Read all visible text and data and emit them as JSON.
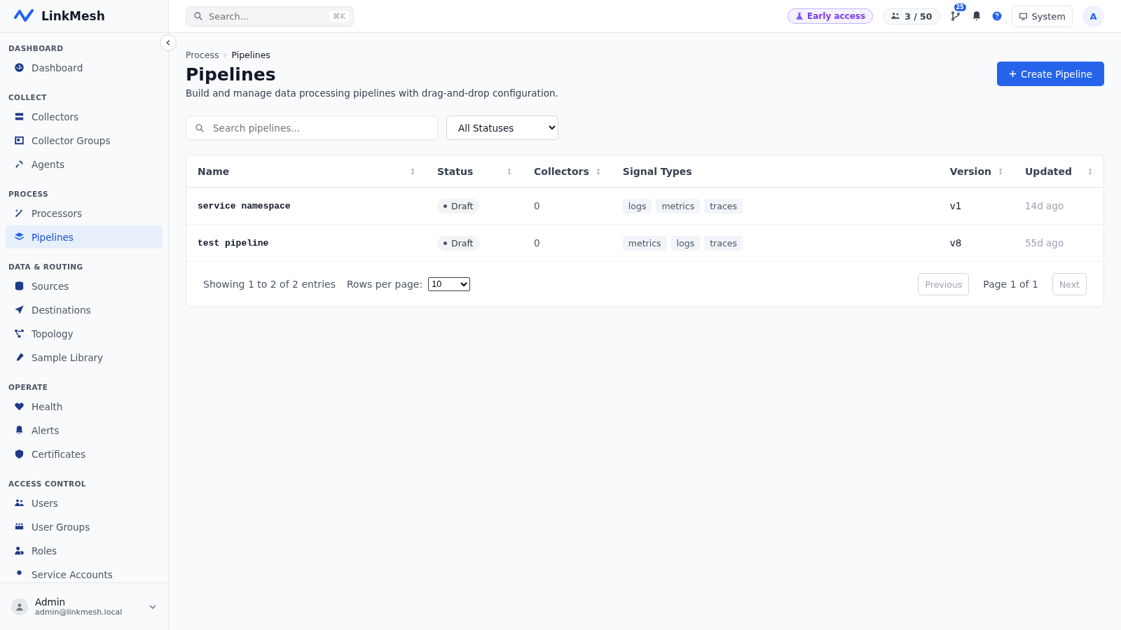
{
  "app": {
    "name": "LinkMesh"
  },
  "topbar": {
    "search": {
      "placeholder": "Search...",
      "shortcut": "⌘K"
    },
    "early_access": "Early access",
    "seats": "3 / 50",
    "notifications_count": "25",
    "theme": "System",
    "avatar": "A"
  },
  "sidebar": {
    "sections": [
      {
        "title": "DASHBOARD",
        "items": [
          {
            "label": "Dashboard",
            "selected": false
          }
        ]
      },
      {
        "title": "COLLECT",
        "items": [
          {
            "label": "Collectors",
            "selected": false
          },
          {
            "label": "Collector Groups",
            "selected": false
          },
          {
            "label": "Agents",
            "selected": false
          }
        ]
      },
      {
        "title": "PROCESS",
        "items": [
          {
            "label": "Processors",
            "selected": false
          },
          {
            "label": "Pipelines",
            "selected": true
          }
        ]
      },
      {
        "title": "DATA & ROUTING",
        "items": [
          {
            "label": "Sources",
            "selected": false
          },
          {
            "label": "Destinations",
            "selected": false
          },
          {
            "label": "Topology",
            "selected": false
          },
          {
            "label": "Sample Library",
            "selected": false
          }
        ]
      },
      {
        "title": "OPERATE",
        "items": [
          {
            "label": "Health",
            "selected": false
          },
          {
            "label": "Alerts",
            "selected": false
          },
          {
            "label": "Certificates",
            "selected": false
          }
        ]
      },
      {
        "title": "ACCESS CONTROL",
        "items": [
          {
            "label": "Users",
            "selected": false
          },
          {
            "label": "User Groups",
            "selected": false
          },
          {
            "label": "Roles",
            "selected": false
          },
          {
            "label": "Service Accounts",
            "selected": false
          }
        ]
      }
    ],
    "user": {
      "name": "Admin",
      "email": "admin@linkmesh.local"
    }
  },
  "breadcrumb": [
    "Process",
    "Pipelines"
  ],
  "page": {
    "title": "Pipelines",
    "description": "Build and manage data processing pipelines with drag-and-drop configuration.",
    "create_button": "Create Pipeline"
  },
  "filters": {
    "search_placeholder": "Search pipelines...",
    "status_filter": "All Statuses"
  },
  "table": {
    "columns": [
      {
        "label": "Name",
        "sortable": true
      },
      {
        "label": "Status",
        "sortable": true
      },
      {
        "label": "Collectors",
        "sortable": true
      },
      {
        "label": "Signal Types",
        "sortable": false
      },
      {
        "label": "Version",
        "sortable": true
      },
      {
        "label": "Updated",
        "sortable": true
      }
    ],
    "rows": [
      {
        "name": "service namespace",
        "status": "Draft",
        "collectors": "0",
        "signal_types": [
          "logs",
          "metrics",
          "traces"
        ],
        "version": "v1",
        "updated": "14d ago"
      },
      {
        "name": "test pipeline",
        "status": "Draft",
        "collectors": "0",
        "signal_types": [
          "metrics",
          "logs",
          "traces"
        ],
        "version": "v8",
        "updated": "55d ago"
      }
    ]
  },
  "pagination": {
    "summary": "Showing 1 to 2 of 2 entries",
    "rows_per_page_label": "Rows per page:",
    "rows_per_page": "10",
    "previous": {
      "label": "Previous",
      "disabled": true
    },
    "page_info": "Page 1 of 1",
    "next": {
      "label": "Next",
      "disabled": true
    }
  }
}
